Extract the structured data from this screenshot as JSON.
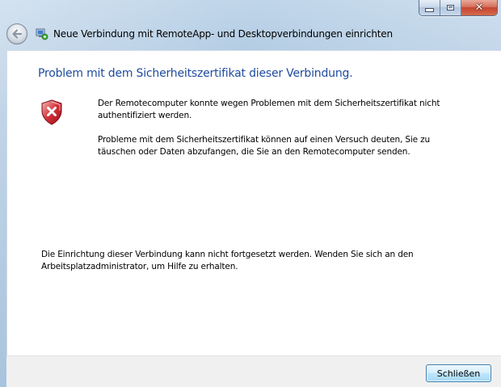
{
  "window": {
    "title": "Neue Verbindung mit RemoteApp- und Desktopverbindungen einrichten",
    "icons": {
      "back": "back-arrow-icon",
      "app": "remoteapp-icon",
      "minimize": "minimize-icon",
      "maximize": "maximize-icon",
      "close": "close-icon"
    },
    "close_glyph": "✕"
  },
  "content": {
    "heading": "Problem mit dem Sicherheitszertifikat dieser Verbindung.",
    "status_icon": "error-shield-icon",
    "message_1": "Der Remotecomputer konnte wegen Problemen mit dem Sicherheitszertifikat nicht authentifiziert werden.",
    "message_2": " Probleme mit dem Sicherheitszertifikat können auf einen Versuch deuten, Sie zu täuschen oder Daten abzufangen, die Sie an den Remotecomputer senden.",
    "footer_note": "Die Einrichtung dieser Verbindung kann nicht fortgesetzt werden. Wenden Sie sich an den Arbeitsplatzadministrator, um Hilfe zu erhalten."
  },
  "buttons": {
    "close_label": "Schließen"
  },
  "colors": {
    "heading": "#1e4b9e",
    "shield_red": "#c8102e",
    "button_border": "#3c7fb1"
  }
}
